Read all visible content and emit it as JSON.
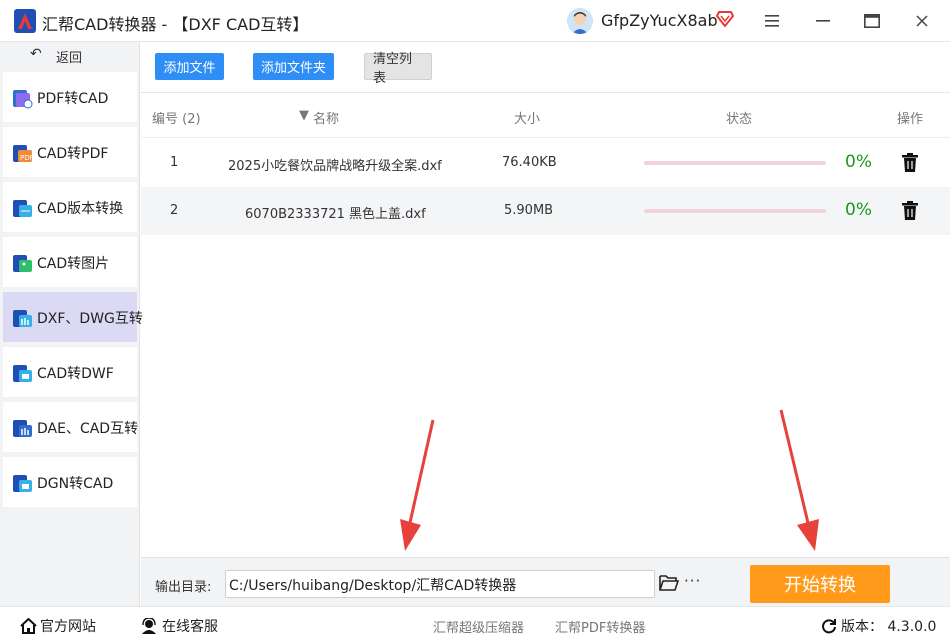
{
  "window": {
    "title": "汇帮CAD转换器 - 【DXF CAD互转】",
    "username": "GfpZyYucX8ab"
  },
  "colors": {
    "accent_blue": "#2f8ef5",
    "start_orange": "#ff9a1a",
    "active_nav": "#dcd9f5",
    "percent_green": "#1a9a1a",
    "arrow_red": "#e8413c"
  },
  "sidebar": {
    "back_label": "返回",
    "items": [
      {
        "label": "PDF转CAD",
        "icon": "pdf-to-cad-icon"
      },
      {
        "label": "CAD转PDF",
        "icon": "cad-to-pdf-icon"
      },
      {
        "label": "CAD版本转换",
        "icon": "cad-version-icon"
      },
      {
        "label": "CAD转图片",
        "icon": "cad-to-image-icon"
      },
      {
        "label": "DXF、DWG互转",
        "icon": "dxf-dwg-icon"
      },
      {
        "label": "CAD转DWF",
        "icon": "cad-to-dwf-icon"
      },
      {
        "label": "DAE、CAD互转",
        "icon": "dae-cad-icon"
      },
      {
        "label": "DGN转CAD",
        "icon": "dgn-to-cad-icon"
      }
    ],
    "active_index": 4
  },
  "toolbar": {
    "add_file": "添加文件",
    "add_folder": "添加文件夹",
    "clear_list": "清空列表"
  },
  "table": {
    "headers": {
      "index": "编号 (2)",
      "name": "名称",
      "size": "大小",
      "status": "状态",
      "action": "操作"
    },
    "rows": [
      {
        "index": "1",
        "name": "2025小吃餐饮品牌战略升级全案.dxf",
        "size": "76.40KB",
        "progress": 0,
        "percent": "0%"
      },
      {
        "index": "2",
        "name": "6070B2333721 黑色上盖.dxf",
        "size": "5.90MB",
        "progress": 0,
        "percent": "0%"
      }
    ]
  },
  "output": {
    "label": "输出目录:",
    "path": "C:/Users/huibang/Desktop/汇帮CAD转换器",
    "more": "···",
    "start_button": "开始转换"
  },
  "statusbar": {
    "website": "官方网站",
    "support": "在线客服",
    "link1": "汇帮超级压缩器",
    "link2": "汇帮PDF转换器",
    "version": "版本： 4.3.0.0"
  }
}
